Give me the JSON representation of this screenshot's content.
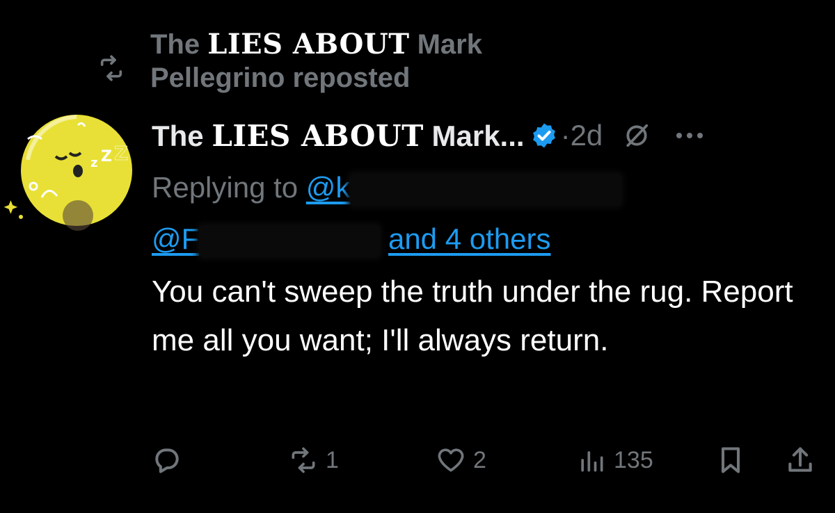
{
  "repost": {
    "prefix": "The",
    "emphasis": "LIES ABOUT",
    "suffix": "Mark Pellegrino reposted"
  },
  "author": {
    "display_prefix": "The",
    "display_emphasis": "LIES ABOUT",
    "display_suffix": "Mark...",
    "separator": "·",
    "time": "2d"
  },
  "reply": {
    "prefix": "Replying to",
    "mention1": "@k",
    "mention2": "@F",
    "others": "and 4 others"
  },
  "body": {
    "text": "You can't sweep the truth under the rug. Report me all you want; I'll always return."
  },
  "actions": {
    "reposts": "1",
    "likes": "2",
    "views": "135"
  },
  "colors": {
    "background": "#000000",
    "muted": "#71767b",
    "link": "#1d9bf0",
    "avatar": "#e8e036"
  }
}
